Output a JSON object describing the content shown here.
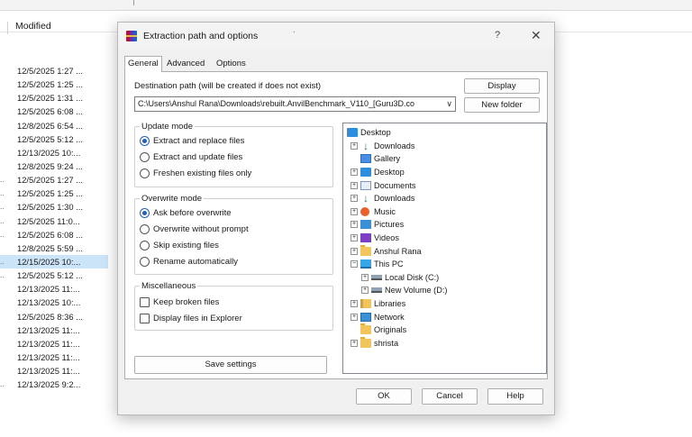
{
  "explorer": {
    "column_header": "Modified",
    "rows": [
      {
        "marker": "",
        "date": "12/5/2025 1:27 ..."
      },
      {
        "marker": "",
        "date": "12/5/2025 1:25 ..."
      },
      {
        "marker": "",
        "date": "12/5/2025 1:31 ..."
      },
      {
        "marker": "",
        "date": "12/5/2025 6:08 ..."
      },
      {
        "marker": "",
        "date": "12/8/2025 6:54 ..."
      },
      {
        "marker": "",
        "date": "12/5/2025 5:12 ..."
      },
      {
        "marker": "",
        "date": "12/13/2025 10:..."
      },
      {
        "marker": "",
        "date": "12/8/2025 9:24 ..."
      },
      {
        "marker": "..",
        "date": "12/5/2025 1:27 ..."
      },
      {
        "marker": "..",
        "date": "12/5/2025 1:25 ..."
      },
      {
        "marker": "..",
        "date": "12/5/2025 1:30 ..."
      },
      {
        "marker": "..",
        "date": "12/5/2025 11:0..."
      },
      {
        "marker": "..",
        "date": "12/5/2025 6:08 ..."
      },
      {
        "marker": "",
        "date": "12/8/2025 5:59 ..."
      },
      {
        "marker": "..",
        "date": "12/15/2025 10:...",
        "selected": true
      },
      {
        "marker": "..",
        "date": "12/5/2025 5:12 ..."
      },
      {
        "marker": "",
        "date": "12/13/2025 11:..."
      },
      {
        "marker": "",
        "date": "12/13/2025 10:..."
      },
      {
        "marker": "",
        "date": "12/5/2025 8:36 ..."
      },
      {
        "marker": "",
        "date": "12/13/2025 11:..."
      },
      {
        "marker": "",
        "date": "12/13/2025 11:..."
      },
      {
        "marker": "",
        "date": "12/13/2025 11:..."
      },
      {
        "marker": "",
        "date": "12/13/2025 11:..."
      },
      {
        "marker": "..",
        "date": "12/13/2025 9:2..."
      }
    ]
  },
  "dialog": {
    "title": "Extraction path and options",
    "help_glyph": "?",
    "close_glyph": "✕",
    "tabs": [
      "General",
      "Advanced",
      "Options"
    ],
    "destination_label": "Destination path (will be created if does not exist)",
    "destination_value": "C:\\Users\\Anshul Rana\\Downloads\\rebuilt.AnvilBenchmark_V110_[Guru3D.co",
    "display_button": "Display",
    "new_folder_button": "New folder",
    "update_mode": {
      "title": "Update mode",
      "options": [
        "Extract and replace files",
        "Extract and update files",
        "Freshen existing files only"
      ],
      "selected": 0
    },
    "overwrite_mode": {
      "title": "Overwrite mode",
      "options": [
        "Ask before overwrite",
        "Overwrite without prompt",
        "Skip existing files",
        "Rename automatically"
      ],
      "selected": 0
    },
    "misc": {
      "title": "Miscellaneous",
      "options": [
        "Keep broken files",
        "Display files in Explorer"
      ]
    },
    "save_settings_button": "Save settings",
    "tree": [
      {
        "label": "Desktop",
        "icon": "desktop-icon",
        "indent": 0,
        "expander": ""
      },
      {
        "label": "Downloads",
        "icon": "downloads-icon",
        "indent": 1,
        "expander": "+"
      },
      {
        "label": "Gallery",
        "icon": "gallery-icon",
        "indent": 1,
        "expander": ""
      },
      {
        "label": "Desktop",
        "icon": "desktop-icon",
        "indent": 1,
        "expander": "+"
      },
      {
        "label": "Documents",
        "icon": "documents-icon",
        "indent": 1,
        "expander": "+"
      },
      {
        "label": "Downloads",
        "icon": "downloads-icon",
        "indent": 1,
        "expander": "+"
      },
      {
        "label": "Music",
        "icon": "music-icon",
        "indent": 1,
        "expander": "+"
      },
      {
        "label": "Pictures",
        "icon": "pictures-icon",
        "indent": 1,
        "expander": "+"
      },
      {
        "label": "Videos",
        "icon": "videos-icon",
        "indent": 1,
        "expander": "+"
      },
      {
        "label": "Anshul Rana",
        "icon": "folder-icon",
        "indent": 1,
        "expander": "+"
      },
      {
        "label": "This PC",
        "icon": "pc-icon",
        "indent": 1,
        "expander": "−"
      },
      {
        "label": "Local Disk (C:)",
        "icon": "disk-icon",
        "indent": 2,
        "expander": "+"
      },
      {
        "label": "New Volume (D:)",
        "icon": "disk-icon",
        "indent": 2,
        "expander": "+"
      },
      {
        "label": "Libraries",
        "icon": "libraries-icon",
        "indent": 1,
        "expander": "+"
      },
      {
        "label": "Network",
        "icon": "network-icon",
        "indent": 1,
        "expander": "+"
      },
      {
        "label": "Originals",
        "icon": "folder-icon",
        "indent": 1,
        "expander": ""
      },
      {
        "label": "shrista",
        "icon": "folder-icon",
        "indent": 1,
        "expander": "+"
      }
    ],
    "ok_button": "OK",
    "cancel_button": "Cancel",
    "help_button": "Help"
  }
}
